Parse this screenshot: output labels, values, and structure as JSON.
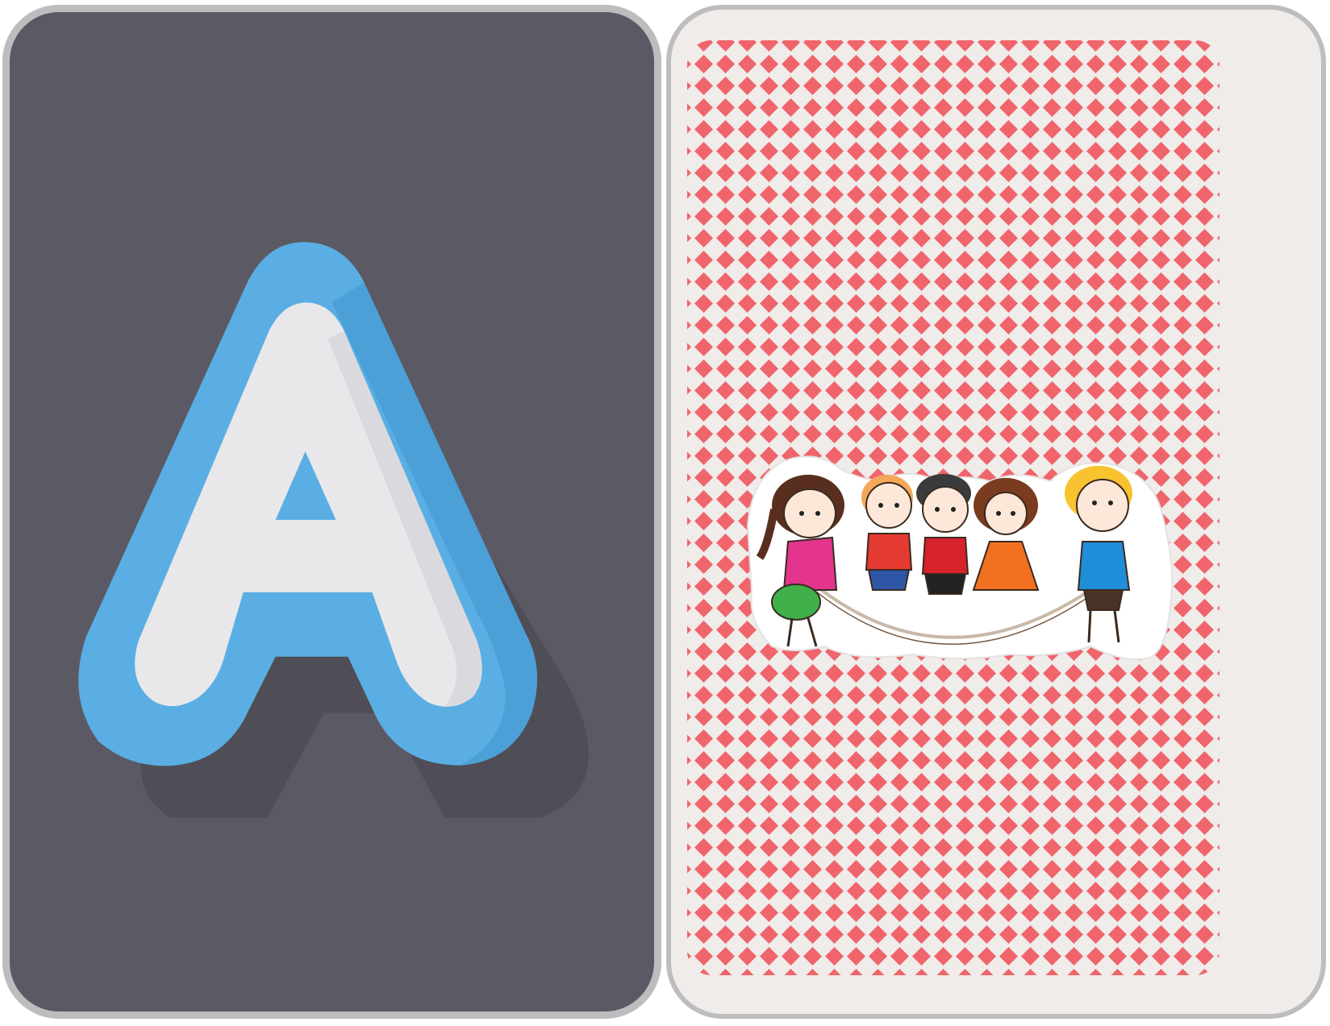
{
  "cards": [
    {
      "side": "front",
      "letter": "A",
      "colors": {
        "background": "#5b5a64",
        "frame": "#bdbdbf",
        "letter_face": "#e8e8ea",
        "letter_outline": "#5aaee3",
        "letter_outline_dark": "#3f95d0",
        "shadow": "#4d4c55"
      }
    },
    {
      "side": "back",
      "pattern": "diamond-lattice",
      "illustration": "kids-jumping-rope-sticker",
      "colors": {
        "background": "#efecea",
        "frame": "#bdbdbf",
        "pattern": "#f0646b"
      }
    }
  ]
}
